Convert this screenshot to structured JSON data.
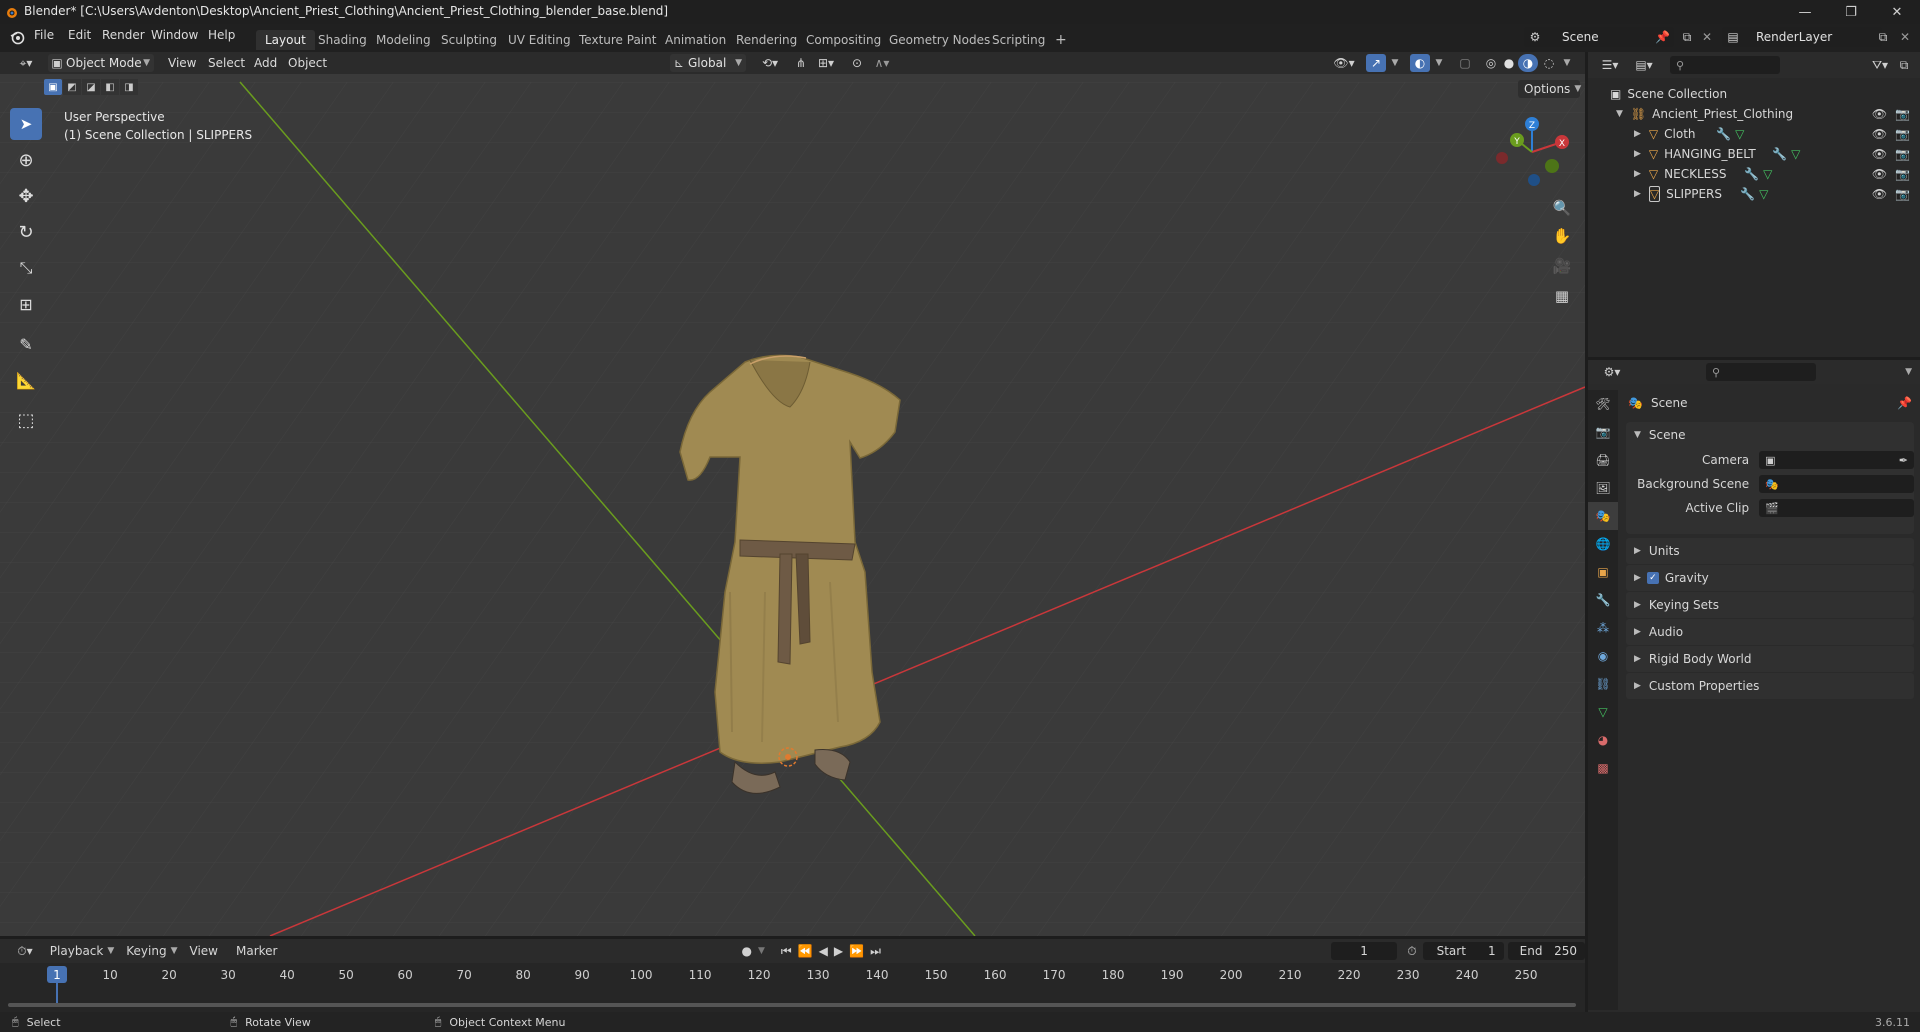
{
  "window": {
    "title": "Blender* [C:\\Users\\Avdenton\\Desktop\\Ancient_Priest_Clothing\\Ancient_Priest_Clothing_blender_base.blend]",
    "controls": [
      "—",
      "❐",
      "✕"
    ]
  },
  "menu": [
    "File",
    "Edit",
    "Render",
    "Window",
    "Help"
  ],
  "workspaces": [
    "Layout",
    "Shading",
    "Modeling",
    "Sculpting",
    "UV Editing",
    "Texture Paint",
    "Animation",
    "Rendering",
    "Compositing",
    "Geometry Nodes",
    "Scripting",
    "+"
  ],
  "active_workspace": "Layout",
  "scene_selector": {
    "scene": "Scene",
    "view_layer": "RenderLayer"
  },
  "viewport": {
    "mode": "Object Mode",
    "menus": [
      "View",
      "Select",
      "Add",
      "Object"
    ],
    "orientation": "Global",
    "options_label": "Options",
    "overlay_text_1": "User Perspective",
    "overlay_text_2": "(1) Scene Collection | SLIPPERS",
    "gizmo_axes": [
      "X",
      "Y",
      "Z"
    ]
  },
  "outliner": {
    "root": "Scene Collection",
    "collection": "Ancient_Priest_Clothing",
    "objects": [
      "Cloth",
      "HANGING_BELT",
      "NECKLESS",
      "SLIPPERS"
    ]
  },
  "properties": {
    "context": "Scene",
    "section": "Scene",
    "fields": [
      {
        "label": "Camera"
      },
      {
        "label": "Background Scene"
      },
      {
        "label": "Active Clip"
      }
    ],
    "collapsed_panels": [
      "Units",
      "Gravity",
      "Keying Sets",
      "Audio",
      "Rigid Body World",
      "Custom Properties"
    ]
  },
  "timeline": {
    "menus": [
      "Playback",
      "Keying",
      "View",
      "Marker"
    ],
    "current_frame": "1",
    "start_label": "Start",
    "start": "1",
    "end_label": "End",
    "end": "250",
    "ticks": [
      "1",
      "10",
      "20",
      "30",
      "40",
      "50",
      "60",
      "70",
      "80",
      "90",
      "100",
      "110",
      "120",
      "130",
      "140",
      "150",
      "160",
      "170",
      "180",
      "190",
      "200",
      "210",
      "220",
      "230",
      "240",
      "250"
    ]
  },
  "status": {
    "items": [
      "Select",
      "Rotate View",
      "Object Context Menu"
    ],
    "version": "3.6.11"
  },
  "colors": {
    "accent": "#4772b3",
    "x_axis": "#c9373a",
    "y_axis": "#6a9d1e",
    "z_axis": "#2e7fd6",
    "robe": "#a08a52"
  }
}
